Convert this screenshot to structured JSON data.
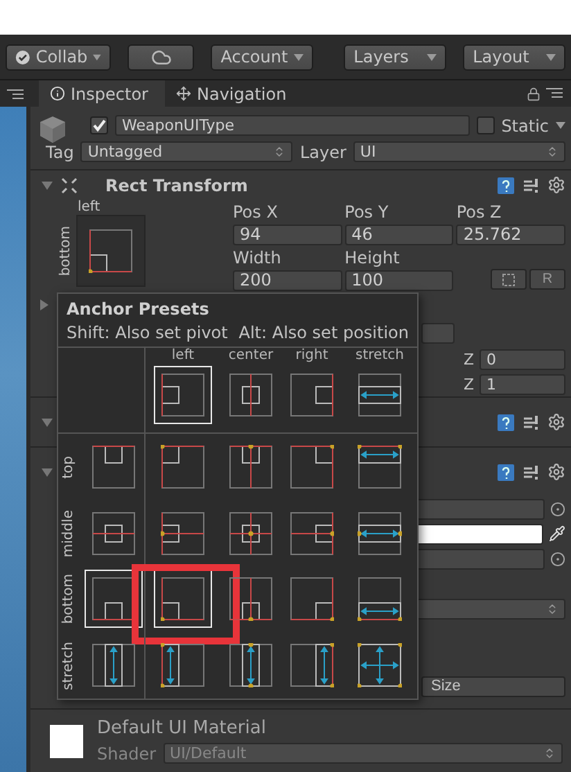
{
  "toolbar": [
    {
      "kind": "collab",
      "label": "Collab"
    },
    {
      "kind": "cloud"
    },
    {
      "kind": "dropdown",
      "label": "Account"
    },
    {
      "kind": "dropdown",
      "label": "Layers"
    },
    {
      "kind": "dropdown",
      "label": "Layout"
    }
  ],
  "tabs": [
    {
      "label": "Inspector",
      "selected": true
    },
    {
      "label": "Navigation",
      "selected": false
    }
  ],
  "object": {
    "enabled": true,
    "name": "WeaponUIType",
    "static": false,
    "static_label": "Static",
    "tag_label": "Tag",
    "tag": "Untagged",
    "layer_label": "Layer",
    "layer": "UI"
  },
  "rect_transform": {
    "title": "Rect Transform",
    "h_label": "left",
    "v_label": "bottom",
    "rows": [
      [
        {
          "label": "Pos X",
          "value": "94"
        },
        {
          "label": "Pos Y",
          "value": "46"
        },
        {
          "label": "Pos Z",
          "value": "25.762"
        }
      ],
      [
        {
          "label": "Width",
          "value": "200"
        },
        {
          "label": "Height",
          "value": "100"
        }
      ]
    ],
    "reset_label": "R"
  },
  "popup": {
    "title": "Anchor Presets",
    "hint_shift": "Shift: Also set pivot",
    "hint_alt": "Alt: Also set position",
    "columns": [
      {
        "kind": "left",
        "label": "left",
        "selected": true
      },
      {
        "kind": "center",
        "label": "center",
        "selected": false
      },
      {
        "kind": "right",
        "label": "right",
        "selected": false
      },
      {
        "kind": "stretch",
        "label": "stretch",
        "selected": false
      }
    ],
    "rows": [
      {
        "kind": "top",
        "label": "top",
        "selected": false
      },
      {
        "kind": "middle",
        "label": "middle",
        "selected": false
      },
      {
        "kind": "bottom",
        "label": "bottom",
        "selected": true
      },
      {
        "kind": "stretch",
        "label": "stretch",
        "selected": false
      }
    ],
    "highlight": true
  },
  "background_rows": [
    {
      "kind": "fold"
    },
    {
      "kind": "field"
    },
    {
      "kind": "z",
      "label": "Z",
      "value": "0"
    },
    {
      "kind": "z",
      "label": "Z",
      "value": "1"
    },
    {
      "kind": "component"
    },
    {
      "kind": "component"
    },
    {
      "kind": "object"
    },
    {
      "kind": "color"
    },
    {
      "kind": "object"
    },
    {
      "kind": "dropdown"
    },
    {
      "kind": "button",
      "label": "Size"
    }
  ],
  "material": {
    "name": "Default UI Material",
    "shader_label": "Shader",
    "shader": "UI/Default"
  }
}
